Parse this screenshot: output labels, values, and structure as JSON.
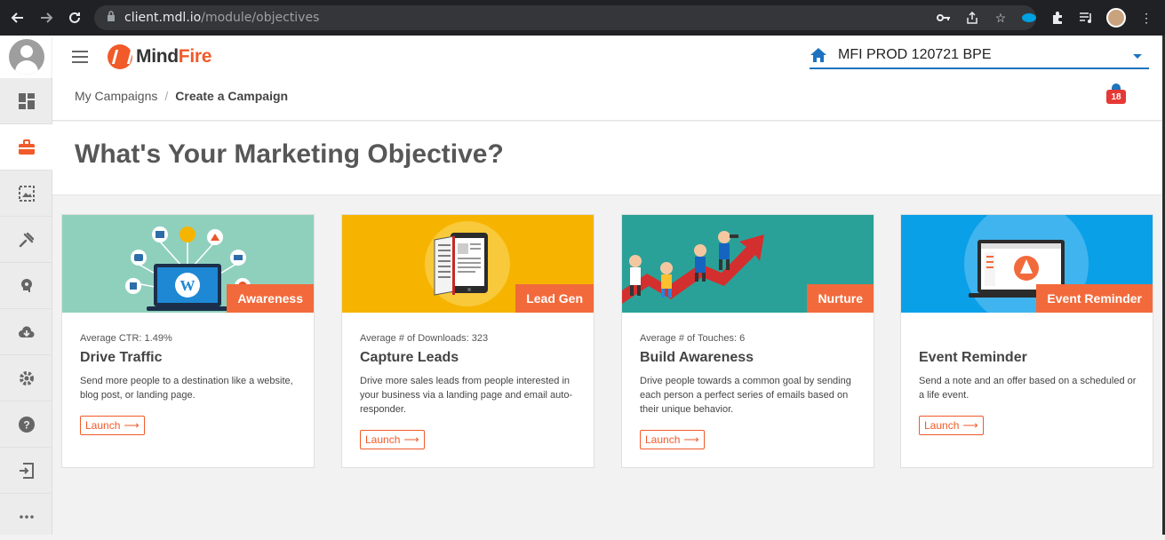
{
  "browser": {
    "url_host": "client.mdl.io",
    "url_path": "/module/objectives"
  },
  "rail": {
    "items": [
      {
        "name": "dashboard-icon",
        "active": false
      },
      {
        "name": "campaigns-icon",
        "active": true
      },
      {
        "name": "media-icon",
        "active": false
      },
      {
        "name": "integrations-icon",
        "active": false
      },
      {
        "name": "insights-icon",
        "active": false
      },
      {
        "name": "cloud-download-icon",
        "active": false
      },
      {
        "name": "settings-icon",
        "active": false
      },
      {
        "name": "help-icon",
        "active": false
      },
      {
        "name": "logout-icon",
        "active": false
      },
      {
        "name": "more-icon",
        "active": false
      }
    ]
  },
  "header": {
    "logo_part1": "Mind",
    "logo_part2": "Fire",
    "account_name": "MFI PROD 120721 BPE"
  },
  "breadcrumb": {
    "root": "My Campaigns",
    "separator": "/",
    "current": "Create a Campaign"
  },
  "notifications": {
    "count": "18"
  },
  "page": {
    "title": "What's Your Marketing Objective?"
  },
  "cards": [
    {
      "tag": "Awareness",
      "meta": "Average CTR: 1.49%",
      "title": "Drive Traffic",
      "description": "Send more people to a destination like a website, blog post, or landing page.",
      "launch": "Launch",
      "image_bg": "#8fd0bd"
    },
    {
      "tag": "Lead Gen",
      "meta": "Average # of Downloads: 323",
      "title": "Capture Leads",
      "description": "Drive more sales leads from people interested in your business via a landing page and email auto-responder.",
      "launch": "Launch",
      "image_bg": "#f6b400"
    },
    {
      "tag": "Nurture",
      "meta": "Average # of Touches: 6",
      "title": "Build Awareness",
      "description": "Drive people towards a common goal by sending each person a perfect series of emails based on their unique behavior.",
      "launch": "Launch",
      "image_bg": "#2aa198"
    },
    {
      "tag": "Event Reminder",
      "meta": "",
      "title": "Event Reminder",
      "description": "Send a note and an offer based on a scheduled or a life event.",
      "launch": "Launch",
      "image_bg": "#0aa0e8"
    }
  ],
  "colors": {
    "accent": "#f15a29",
    "link_blue": "#1e73be"
  }
}
